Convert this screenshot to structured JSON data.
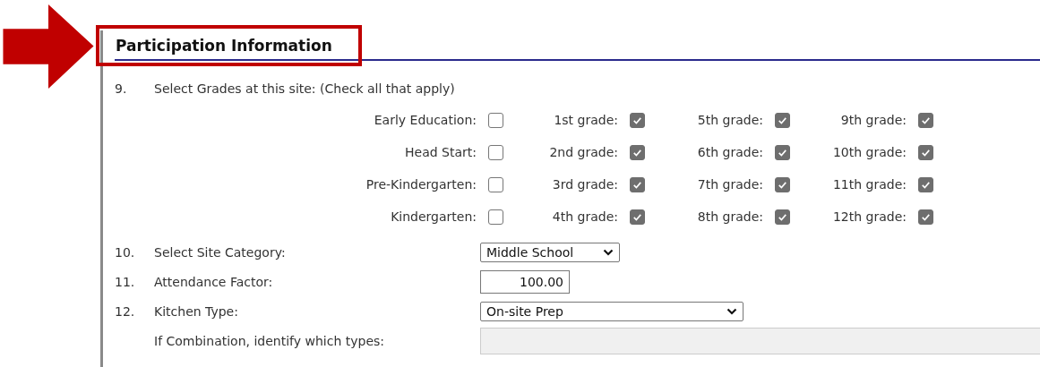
{
  "section": {
    "title": "Participation Information",
    "highlighted": true
  },
  "question": {
    "number": "9.",
    "label": "Select Grades at this site: (Check all that apply)"
  },
  "grade_options": [
    {
      "label": "Early Education:",
      "checked": false
    },
    {
      "label": "1st grade:",
      "checked": true
    },
    {
      "label": "5th grade:",
      "checked": true
    },
    {
      "label": "9th grade:",
      "checked": true
    },
    {
      "label": "Head Start:",
      "checked": false
    },
    {
      "label": "2nd grade:",
      "checked": true
    },
    {
      "label": "6th grade:",
      "checked": true
    },
    {
      "label": "10th grade:",
      "checked": true
    },
    {
      "label": "Pre-Kindergarten:",
      "checked": false
    },
    {
      "label": "3rd grade:",
      "checked": true
    },
    {
      "label": "7th grade:",
      "checked": true
    },
    {
      "label": "11th grade:",
      "checked": true
    },
    {
      "label": "Kindergarten:",
      "checked": false
    },
    {
      "label": "4th grade:",
      "checked": true
    },
    {
      "label": "8th grade:",
      "checked": true
    },
    {
      "label": "12th grade:",
      "checked": true
    }
  ],
  "fields": [
    {
      "number": "10.",
      "label": "Select Site Category:",
      "kind": "select",
      "value": "Middle School"
    },
    {
      "number": "11.",
      "label": "Attendance Factor:",
      "kind": "text",
      "value": "100.00"
    },
    {
      "number": "12.",
      "label": "Kitchen Type:",
      "kind": "select",
      "value": "On-site Prep"
    },
    {
      "label": "If Combination, identify which types:",
      "kind": "wide",
      "disabled": true
    }
  ]
}
